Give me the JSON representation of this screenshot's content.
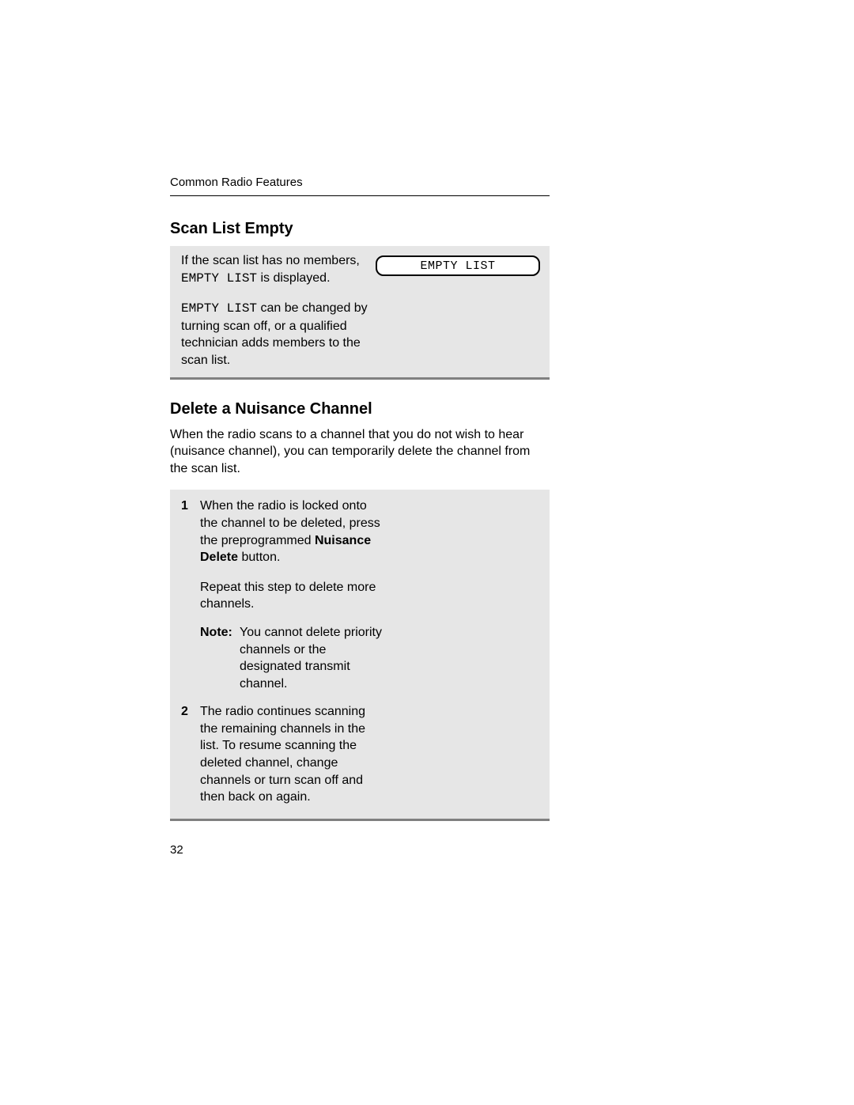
{
  "header": {
    "running": "Common Radio Features"
  },
  "section1": {
    "heading": "Scan List Empty",
    "para1_a": "If the scan list has no members, ",
    "para1_code": "EMPTY LIST",
    "para1_b": " is displayed.",
    "para2_code": "EMPTY LIST",
    "para2_b": " can be changed by turning scan off, or a qualified technician adds members to the scan list.",
    "display": "EMPTY LIST"
  },
  "section2": {
    "heading": "Delete a Nuisance Channel",
    "intro": "When the radio scans to a channel that you do not wish to hear (nuisance channel), you can temporarily delete the channel from the scan list.",
    "step1": {
      "num": "1",
      "text_a": "When the radio is locked onto the channel to be deleted, press the preprogrammed ",
      "bold": "Nuisance Delete",
      "text_b": " button.",
      "sub": "Repeat this step to delete more channels."
    },
    "note": {
      "label": "Note:",
      "text": "You cannot delete priority channels or the designated transmit channel."
    },
    "step2": {
      "num": "2",
      "text": "The radio continues scanning the remaining channels in the list. To resume scanning the deleted channel, change channels or turn scan off and then back on again."
    }
  },
  "page_number": "32"
}
